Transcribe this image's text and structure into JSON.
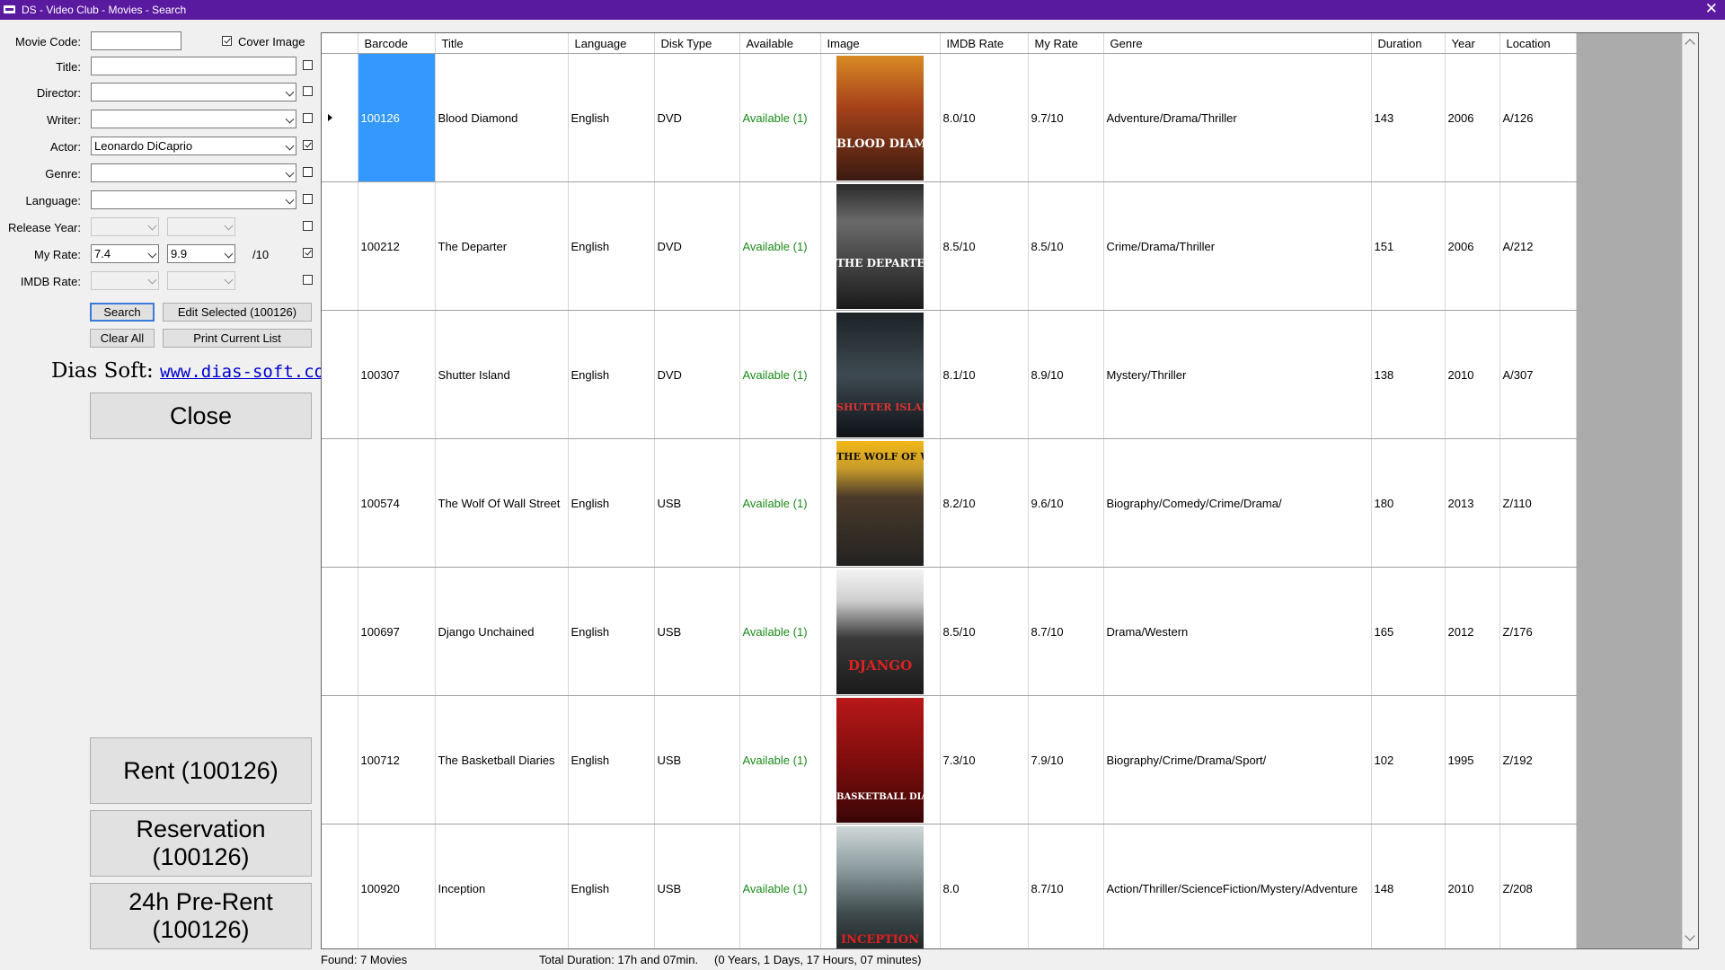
{
  "window": {
    "title": "DS - Video Club - Movies - Search"
  },
  "filters": {
    "movie_code_label": "Movie Code:",
    "movie_code_value": "",
    "cover_image_label": "Cover Image",
    "title_label": "Title:",
    "director_label": "Director:",
    "writer_label": "Writer:",
    "actor_label": "Actor:",
    "actor_value": "Leonardo DiCaprio",
    "genre_label": "Genre:",
    "language_label": "Language:",
    "release_year_label": "Release Year:",
    "my_rate_label": "My Rate:",
    "my_rate_from": "7.4",
    "my_rate_to": "9.9",
    "my_rate_suffix": "/10",
    "imdb_rate_label": "IMDB Rate:"
  },
  "buttons": {
    "search": "Search",
    "edit_selected": "Edit Selected (100126)",
    "clear_all": "Clear All",
    "print_list": "Print Current List",
    "close": "Close",
    "rent": "Rent (100126)",
    "reservation_line1": "Reservation",
    "reservation_line2": "(100126)",
    "prerent_line1": "24h Pre-Rent",
    "prerent_line2": "(100126)"
  },
  "brand": {
    "name": "Dias Soft:",
    "url": "www.dias-soft.com"
  },
  "table": {
    "columns": [
      "Barcode",
      "Title",
      "Language",
      "Disk Type",
      "Available",
      "Image",
      "IMDB Rate",
      "My Rate",
      "Genre",
      "Duration",
      "Year",
      "Location"
    ],
    "rows": [
      {
        "barcode": "100126",
        "title": "Blood Diamond",
        "language": "English",
        "disk": "DVD",
        "available": "Available (1)",
        "poster": "BLOOD DIAMOND",
        "imdb": "8.0/10",
        "myrate": "9.7/10",
        "genre": "Adventure/Drama/Thriller",
        "duration": "143",
        "year": "2006",
        "location": "A/126"
      },
      {
        "barcode": "100212",
        "title": "The Departer",
        "language": "English",
        "disk": "DVD",
        "available": "Available (1)",
        "poster": "THE DEPARTED",
        "imdb": "8.5/10",
        "myrate": "8.5/10",
        "genre": "Crime/Drama/Thriller",
        "duration": "151",
        "year": "2006",
        "location": "A/212"
      },
      {
        "barcode": "100307",
        "title": "Shutter Island",
        "language": "English",
        "disk": "DVD",
        "available": "Available (1)",
        "poster": "SHUTTER ISLAND",
        "imdb": "8.1/10",
        "myrate": "8.9/10",
        "genre": "Mystery/Thriller",
        "duration": "138",
        "year": "2010",
        "location": "A/307"
      },
      {
        "barcode": "100574",
        "title": "The Wolf Of Wall Street",
        "language": "English",
        "disk": "USB",
        "available": "Available (1)",
        "poster": "THE WOLF OF WALL STREET",
        "imdb": "8.2/10",
        "myrate": "9.6/10",
        "genre": "Biography/Comedy/Crime/Drama/",
        "duration": "180",
        "year": "2013",
        "location": "Z/110"
      },
      {
        "barcode": "100697",
        "title": "Django Unchained",
        "language": "English",
        "disk": "USB",
        "available": "Available (1)",
        "poster": "DJANGO",
        "imdb": "8.5/10",
        "myrate": "8.7/10",
        "genre": "Drama/Western",
        "duration": "165",
        "year": "2012",
        "location": "Z/176"
      },
      {
        "barcode": "100712",
        "title": "The Basketball Diaries",
        "language": "English",
        "disk": "USB",
        "available": "Available (1)",
        "poster": "BASKETBALL DIARIES",
        "imdb": "7.3/10",
        "myrate": "7.9/10",
        "genre": "Biography/Crime/Drama/Sport/",
        "duration": "102",
        "year": "1995",
        "location": "Z/192"
      },
      {
        "barcode": "100920",
        "title": "Inception",
        "language": "English",
        "disk": "USB",
        "available": "Available (1)",
        "poster": "INCEPTION",
        "imdb": "8.0",
        "myrate": "8.7/10",
        "genre": "Action/Thriller/ScienceFiction/Mystery/Adventure",
        "duration": "148",
        "year": "2010",
        "location": "Z/208"
      }
    ]
  },
  "status": {
    "found": "Found: 7 Movies",
    "total_duration": "Total Duration: 17h and 07min.",
    "breakdown": "(0 Years, 1 Days, 17 Hours, 07 minutes)"
  },
  "colors": {
    "titlebar": "#5a1aa0",
    "selected": "#3399ff",
    "available": "#1a8a1a",
    "link": "#0000cc"
  }
}
